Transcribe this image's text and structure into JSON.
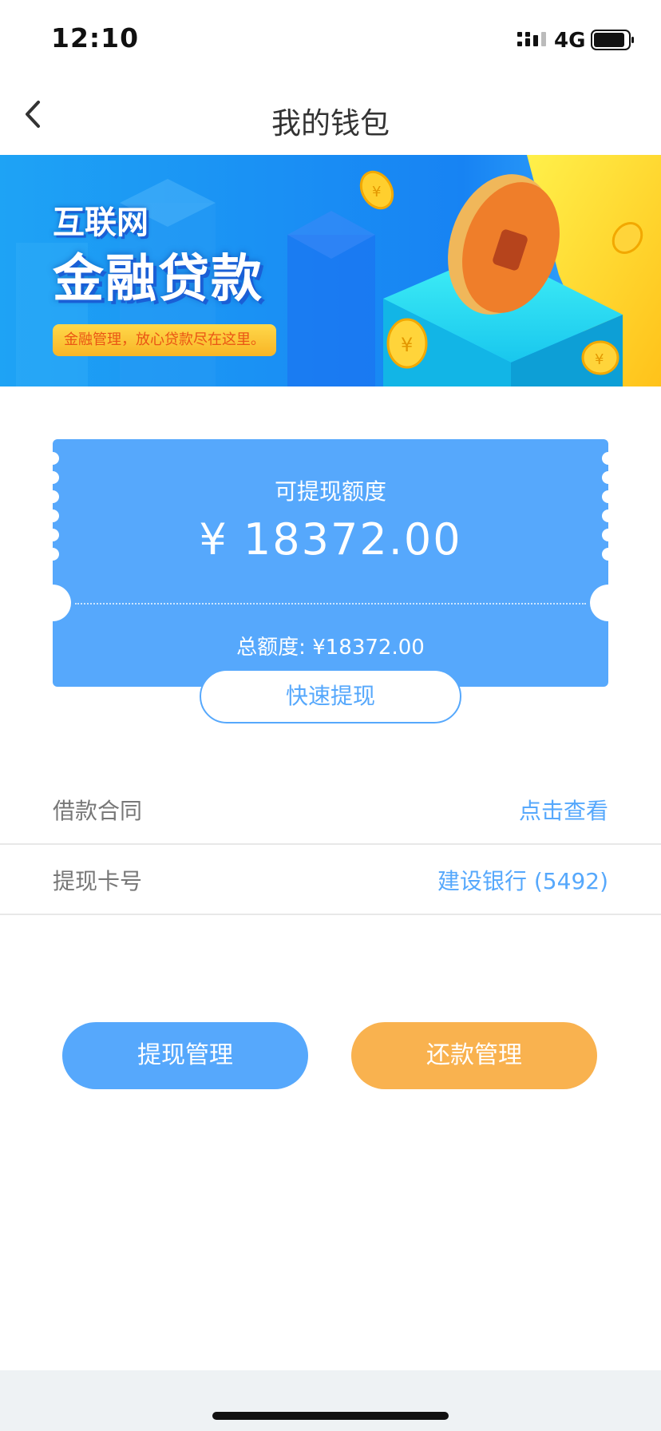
{
  "status_bar": {
    "time": "12:10",
    "network": "4G",
    "icons": [
      "signal-icon",
      "battery-icon"
    ]
  },
  "nav": {
    "title": "我的钱包",
    "back_icon": "chevron-left-icon"
  },
  "banner": {
    "line1": "互联网",
    "line2": "金融贷款",
    "tagline": "金融管理，放心贷款尽在这里。",
    "icons": [
      "coin-icon",
      "yuan-icon"
    ]
  },
  "wallet": {
    "available_label": "可提现额度",
    "available_amount": "¥  18372.00",
    "total_label": "总额度: ¥18372.00",
    "quick_withdraw": "快速提现"
  },
  "rows": [
    {
      "label": "借款合同",
      "value": "点击查看"
    },
    {
      "label": "提现卡号",
      "value": "建设银行 (5492)"
    }
  ],
  "actions": {
    "withdraw_mgmt": "提现管理",
    "repay_mgmt": "还款管理"
  },
  "colors": {
    "primary_blue": "#56a8fc",
    "accent_orange": "#f9b24f",
    "banner_blue": "#1a8cf5",
    "banner_yellow": "#ffd83a",
    "text_gray": "#777777",
    "title_text": "#333333"
  }
}
